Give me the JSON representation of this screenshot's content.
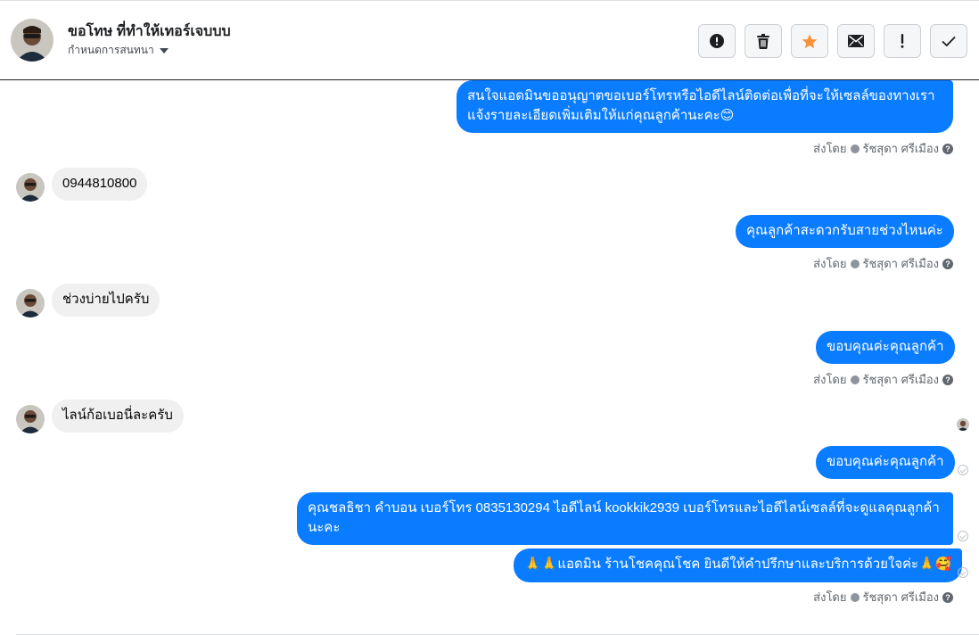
{
  "header": {
    "contact_name": "ขอโทษ ที่ทำให้เทอร์เจบบบ",
    "assign_label": "กำหนดการสนทนา",
    "actions": [
      {
        "name": "mark-spam",
        "icon": "alert-circle-icon"
      },
      {
        "name": "delete",
        "icon": "trash-icon"
      },
      {
        "name": "star",
        "icon": "star-icon",
        "color": "#f7923b"
      },
      {
        "name": "mark-unread",
        "icon": "envelope-icon"
      },
      {
        "name": "follow-up",
        "icon": "exclamation-icon"
      },
      {
        "name": "mark-done",
        "icon": "checkmark-icon"
      }
    ]
  },
  "thread": {
    "sent_by_prefix": "ส่งโดย",
    "sender_name": "รัชสุดา ศรีเมือง",
    "help_glyph": "?",
    "messages": [
      {
        "direction": "out",
        "text": "สนใจแอดมินขออนุญาตขอเบอร์โทรหรือไอดีไลน์ติดต่อเพื่อที่จะให้เซลล์ของทางเราแจ้งรายละเอียดเพิ่มเติมให้แก่คุณลูกค้านะคะ😊"
      },
      {
        "direction": "in",
        "text": "0944810800"
      },
      {
        "direction": "out",
        "text": "คุณลูกค้าสะดวกรับสายช่วงไหนค่ะ"
      },
      {
        "direction": "in",
        "text": "ช่วงบ่ายไปครับ"
      },
      {
        "direction": "out",
        "text": "ขอบคุณค่ะคุณลูกค้า"
      },
      {
        "direction": "in",
        "text": "ไลน์ก้อเบอนี่ละครับ"
      },
      {
        "direction": "out",
        "text": "ขอบคุณค่ะคุณลูกค้า"
      },
      {
        "direction": "out",
        "text": "คุณชลธิชา คำบอน  เบอร์โทร 0835130294  ไอดีไลน์ kookkik2939   เบอร์โทรและไอดีไลน์เซลล์ที่จะดูแลคุณลูกค้านะคะ"
      },
      {
        "direction": "out",
        "text": "🙏🙏แอดมิน ร้านโชคคุณโชค ยินดีให้คำปรึกษาและบริการด้วยใจค่ะ🙏🥰"
      }
    ]
  },
  "colors": {
    "outgoing_bubble": "#0a7cff",
    "incoming_bubble": "#f0f0f0",
    "star": "#f7923b"
  }
}
